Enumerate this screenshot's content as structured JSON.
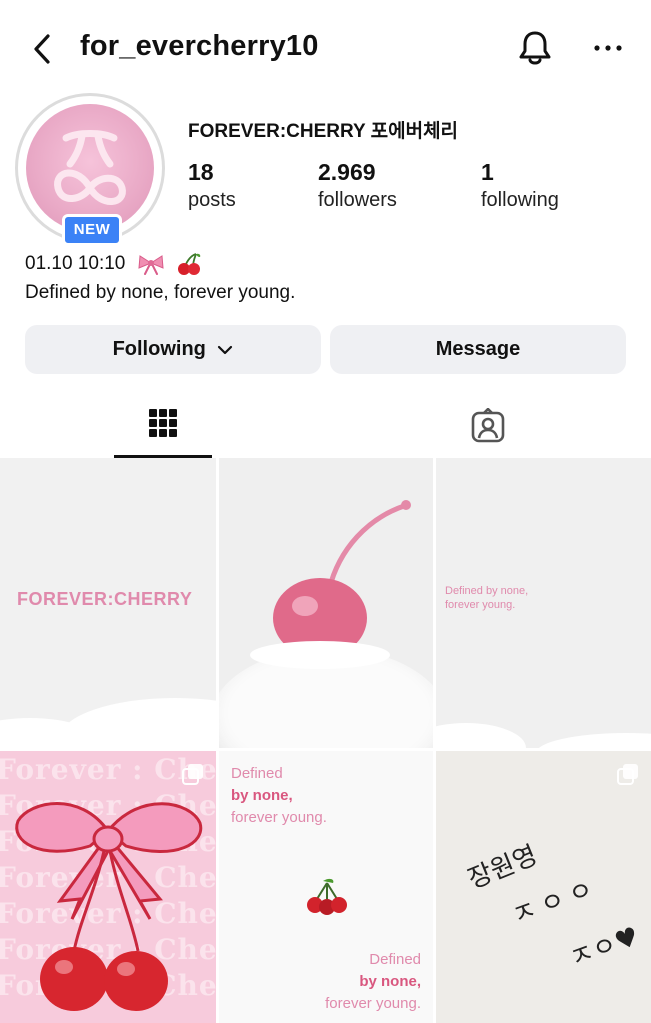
{
  "header": {
    "username": "for_evercherry10",
    "back_icon": "chevron-left-icon",
    "bell_icon": "bell-icon",
    "more_icon": "more-horizontal-icon"
  },
  "profile": {
    "name": "FOREVER:CHERRY 포에버체리",
    "badge": "NEW",
    "stats": [
      {
        "value": "18",
        "label": "posts"
      },
      {
        "value": "2.969",
        "label": "followers"
      },
      {
        "value": "1",
        "label": "following"
      }
    ],
    "bio_line1": "01.10 10:10",
    "bio_emojis": [
      "ribbon",
      "cherries"
    ],
    "bio_line2": "Defined by none, forever young."
  },
  "actions": {
    "following": "Following",
    "message": "Message"
  },
  "tabs": [
    {
      "name": "grid",
      "icon": "grid-icon",
      "active": true
    },
    {
      "name": "tagged",
      "icon": "tagged-person-icon",
      "active": false
    }
  ],
  "posts": {
    "p1_text": "FOREVER:CHERRY",
    "p3_text_line1": "Defined by none,",
    "p3_text_line2": "forever young.",
    "p4_watermark": "Forever : Cherry",
    "p5_top": [
      "Defined",
      "by none,",
      "forever young."
    ],
    "p5_bottom": [
      "Defined",
      "by none,",
      "forever young."
    ],
    "p6_handwriting": [
      "장원영",
      "ㅈㅇㅇ",
      "ㅈㅇ♥"
    ]
  },
  "colors": {
    "accent_pink": "#e08aac",
    "badge_blue": "#3b82f6",
    "button_bg": "#eff0f3"
  }
}
